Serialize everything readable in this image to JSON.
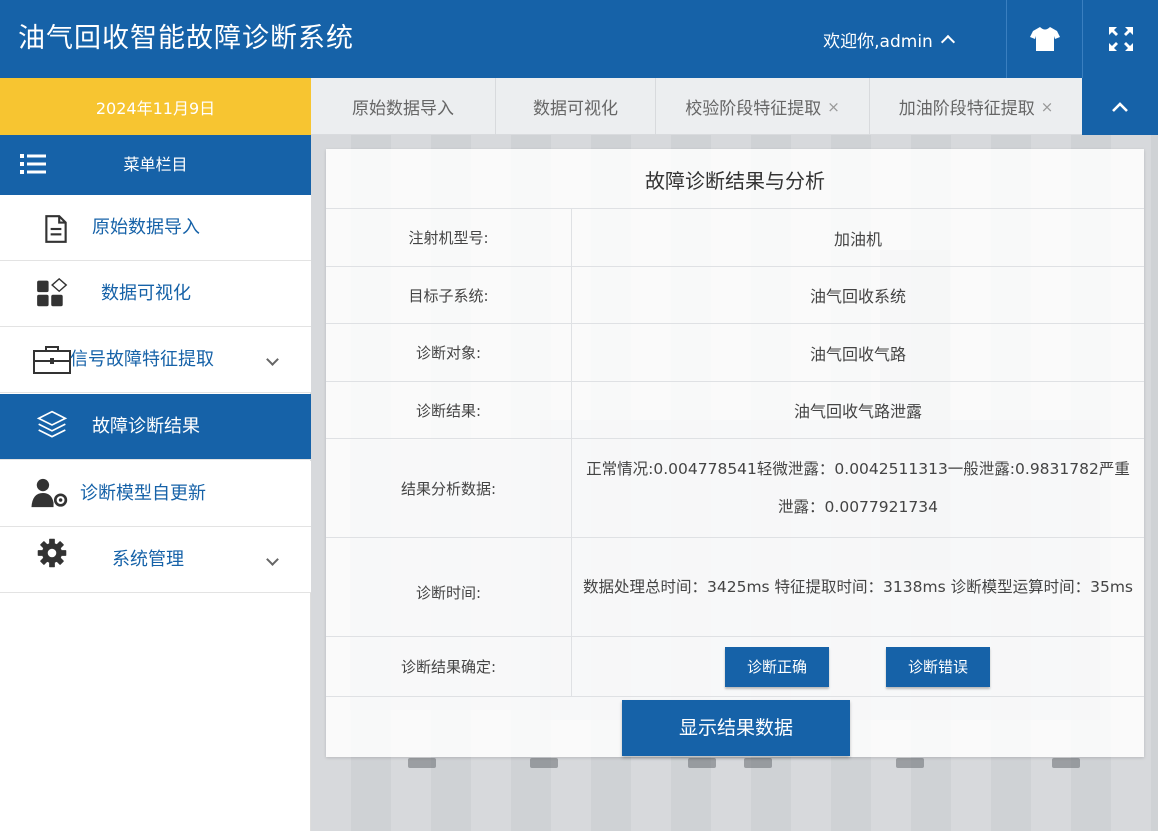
{
  "header": {
    "title": "油气回收智能故障诊断系统",
    "welcome": "欢迎你,admin"
  },
  "icons": {
    "theme": "tshirt-icon",
    "fullscreen": "expand-icon",
    "collapse": "chevron-up-icon"
  },
  "topbar": {
    "date": "2024年11月9日",
    "tabs": [
      {
        "label": "原始数据导入",
        "closable": false
      },
      {
        "label": "数据可视化",
        "closable": false
      },
      {
        "label": "校验阶段特征提取",
        "closable": true
      },
      {
        "label": "加油阶段特征提取",
        "closable": true
      }
    ],
    "close_glyph": "×"
  },
  "sidebar": {
    "header": "菜单栏目",
    "items": [
      {
        "label": "原始数据导入",
        "icon": "document-icon"
      },
      {
        "label": "数据可视化",
        "icon": "blocks-icon"
      },
      {
        "label": "信号故障特征提取",
        "icon": "toolbox-icon",
        "expandable": true
      },
      {
        "label": "故障诊断结果",
        "icon": "layers-icon",
        "active": true
      },
      {
        "label": "诊断模型自更新",
        "icon": "user-gear-icon"
      },
      {
        "label": "系统管理",
        "icon": "gear-icon",
        "expandable": true
      }
    ]
  },
  "panel": {
    "title": "故障诊断结果与分析",
    "rows": [
      {
        "key": "注射机型号:",
        "value": "加油机"
      },
      {
        "key": "目标子系统:",
        "value": "油气回收系统"
      },
      {
        "key": "诊断对象:",
        "value": "油气回收气路"
      },
      {
        "key": "诊断结果:",
        "value": "油气回收气路泄露"
      },
      {
        "key": "结果分析数据:",
        "value": "正常情况:0.004778541轻微泄露：0.0042511313一般泄露:0.9831782严重泄露：0.0077921734"
      },
      {
        "key": "诊断时间:",
        "value": "数据处理总时间：3425ms 特征提取时间：3138ms 诊断模型运算时间：35ms"
      },
      {
        "key": "诊断结果确定:"
      }
    ],
    "confirm_correct": "诊断正确",
    "confirm_wrong": "诊断错误",
    "show_data": "显示结果数据"
  },
  "colors": {
    "primary": "#1662a8",
    "date_bg": "#f7c531"
  }
}
